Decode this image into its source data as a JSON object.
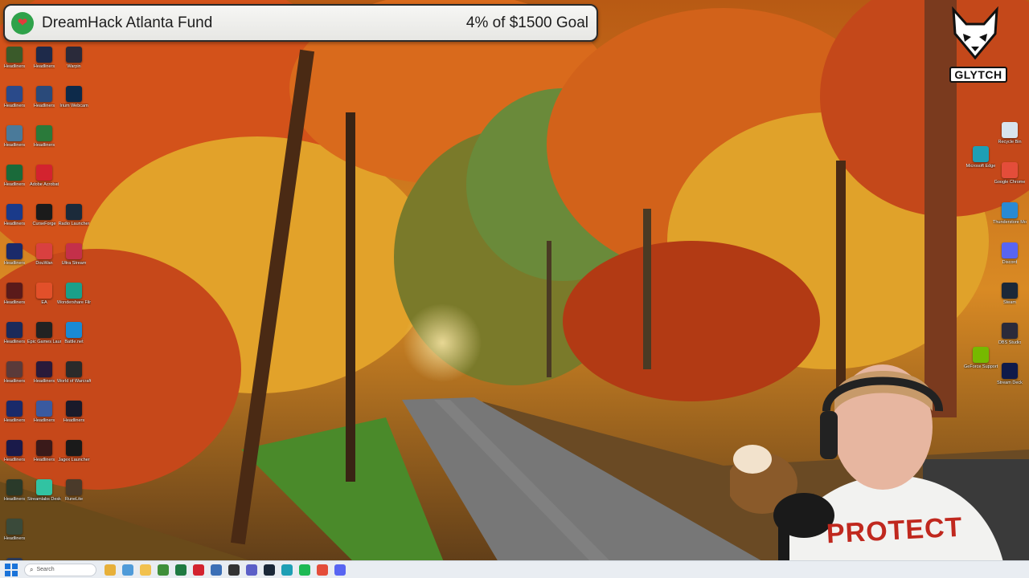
{
  "goal": {
    "title": "DreamHack Atlanta Fund",
    "progress_text": "4% of $1500 Goal",
    "percent": 4,
    "icon": "heart-donation-icon"
  },
  "brand": {
    "name": "GLYTCH"
  },
  "webcam": {
    "shirt_text": "PROTECT"
  },
  "taskbar": {
    "search_placeholder": "Search",
    "apps": [
      {
        "icon": "copilot-icon",
        "color": "#e7b03a"
      },
      {
        "icon": "chrome-app-icon",
        "color": "#4f9bd9"
      },
      {
        "icon": "explorer-icon",
        "color": "#f2c14e"
      },
      {
        "icon": "minecraft-icon",
        "color": "#3f8f3a"
      },
      {
        "icon": "excel-icon",
        "color": "#1f7a42"
      },
      {
        "icon": "adobe-icon",
        "color": "#d3232f"
      },
      {
        "icon": "calculator-icon",
        "color": "#3b6fb6"
      },
      {
        "icon": "obs-icon",
        "color": "#333333"
      },
      {
        "icon": "teams-icon",
        "color": "#5b5fc7"
      },
      {
        "icon": "steam-icon",
        "color": "#1b2838"
      },
      {
        "icon": "edge-icon",
        "color": "#1e9fb5"
      },
      {
        "icon": "spotify-icon",
        "color": "#1db954"
      },
      {
        "icon": "chrome-icon",
        "color": "#e44d3a"
      },
      {
        "icon": "discord-icon",
        "color": "#5865f2"
      }
    ]
  },
  "desktop": {
    "left_col": [
      {
        "label": "Headliners",
        "color": "#3a5a2a"
      },
      {
        "label": "Headliners",
        "color": "#2a4a8a"
      },
      {
        "label": "Headliners",
        "color": "#4a7a9a"
      },
      {
        "label": "Headliners",
        "color": "#1a6a3a"
      },
      {
        "label": "Headliners",
        "color": "#1a3a8a"
      },
      {
        "label": "Headliners",
        "color": "#1a2a6a"
      },
      {
        "label": "Headliners",
        "color": "#5a1a1a"
      },
      {
        "label": "Headliners",
        "color": "#1a2a5a"
      },
      {
        "label": "Headliners",
        "color": "#5a3a3a"
      },
      {
        "label": "Headliners",
        "color": "#1a2a6a"
      },
      {
        "label": "Headliners",
        "color": "#1a1a4a"
      },
      {
        "label": "Headliners",
        "color": "#2a3a2a"
      },
      {
        "label": "Headliners",
        "color": "#3a4a3a"
      },
      {
        "label": "Headliners",
        "color": "#2a3a5a"
      }
    ],
    "mid_col": [
      {
        "label": "Headliners",
        "color": "#1e2a4a"
      },
      {
        "label": "Headliners",
        "color": "#2a4a7a"
      },
      {
        "label": "Headliners",
        "color": "#2a7a3a"
      },
      {
        "label": "Adobe Acrobat",
        "color": "#d3232f"
      },
      {
        "label": "CurseForge",
        "color": "#1b1b1b"
      },
      {
        "label": "DouWan",
        "color": "#d94040"
      },
      {
        "label": "EA",
        "color": "#e2502a"
      },
      {
        "label": "Epic Games Launcher",
        "color": "#222222"
      },
      {
        "label": "Headliners",
        "color": "#2a1a3a"
      },
      {
        "label": "Headliners",
        "color": "#3a5aa0"
      },
      {
        "label": "Headliners",
        "color": "#3a1a1a"
      },
      {
        "label": "Streamlabs Desktop",
        "color": "#31c3a2"
      }
    ],
    "right_col": [
      {
        "label": "Warpin",
        "color": "#2a2a3a"
      },
      {
        "label": "Irium Webcam",
        "color": "#0d2a4a"
      },
      {
        "label": "",
        "color": ""
      },
      {
        "label": "",
        "color": ""
      },
      {
        "label": "Radio Launcher",
        "color": "#1b2a3a"
      },
      {
        "label": "Ultra Stream",
        "color": "#c4304a"
      },
      {
        "label": "Wondershare Filmora 14",
        "color": "#1aa08a"
      },
      {
        "label": "Battle.net",
        "color": "#1a8ad4"
      },
      {
        "label": "World of Warcraft",
        "color": "#2a2a2a"
      },
      {
        "label": "Headliners",
        "color": "#1a1a2a"
      },
      {
        "label": "Jagex Launcher",
        "color": "#1a1a1a"
      },
      {
        "label": "RuneLite",
        "color": "#4a3a2a"
      }
    ],
    "far_right_col": [
      {
        "label": "Recycle Bin",
        "color": "#d8e4ee"
      },
      {
        "label": "Google Chrome",
        "color": "#e44d3a"
      },
      {
        "label": "Thunderstore Mod Mana…",
        "color": "#2a8ad4"
      },
      {
        "label": "Discord",
        "color": "#5865f2"
      },
      {
        "label": "Steam",
        "color": "#1b2838"
      },
      {
        "label": "OBS Studio",
        "color": "#2a2a3a"
      },
      {
        "label": "Stream Deck",
        "color": "#0f1a4a"
      }
    ],
    "far_right_col2": [
      {
        "label": "Microsoft Edge",
        "color": "#1e9fb5"
      },
      {
        "label": "GeForce Support",
        "color": "#76b900"
      }
    ]
  }
}
